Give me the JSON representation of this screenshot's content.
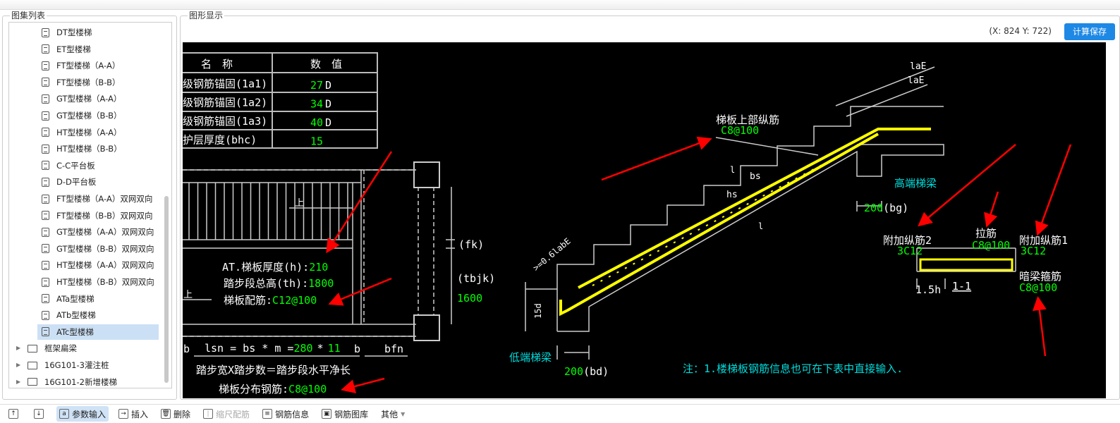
{
  "left_panel": {
    "title": "图集列表",
    "items": [
      {
        "label": "DT型楼梯",
        "type": "file"
      },
      {
        "label": "ET型楼梯",
        "type": "file"
      },
      {
        "label": "FT型楼梯（A-A）",
        "type": "file"
      },
      {
        "label": "FT型楼梯（B-B）",
        "type": "file"
      },
      {
        "label": "GT型楼梯（A-A）",
        "type": "file"
      },
      {
        "label": "GT型楼梯（B-B）",
        "type": "file"
      },
      {
        "label": "HT型楼梯（A-A）",
        "type": "file"
      },
      {
        "label": "HT型楼梯（B-B）",
        "type": "file"
      },
      {
        "label": "C-C平台板",
        "type": "file"
      },
      {
        "label": "D-D平台板",
        "type": "file"
      },
      {
        "label": "FT型楼梯（A-A）双网双向",
        "type": "file"
      },
      {
        "label": "FT型楼梯（B-B）双网双向",
        "type": "file"
      },
      {
        "label": "GT型楼梯（A-A）双网双向",
        "type": "file"
      },
      {
        "label": "GT型楼梯（B-B）双网双向",
        "type": "file"
      },
      {
        "label": "HT型楼梯（A-A）双网双向",
        "type": "file"
      },
      {
        "label": "HT型楼梯（B-B）双网双向",
        "type": "file"
      },
      {
        "label": "ATa型楼梯",
        "type": "file"
      },
      {
        "label": "ATb型楼梯",
        "type": "file"
      },
      {
        "label": "ATc型楼梯",
        "type": "file",
        "selected": true
      },
      {
        "label": "框架扁梁",
        "type": "folder"
      },
      {
        "label": "16G101-3灌注桩",
        "type": "folder"
      },
      {
        "label": "16G101-2新增楼梯",
        "type": "folder"
      }
    ]
  },
  "right_panel": {
    "title": "图形显示",
    "coords": "(X: 824 Y: 722)",
    "calc_save": "计算保存"
  },
  "drawing": {
    "table": {
      "headers": [
        "名　称",
        "数　值"
      ],
      "rows": [
        {
          "name": "级钢筋锚固(1a1)",
          "value": "27",
          "unit": "D"
        },
        {
          "name": "级钢筋锚固(1a2)",
          "value": "34",
          "unit": "D"
        },
        {
          "name": "级钢筋锚固(1a3)",
          "value": "40",
          "unit": "D"
        },
        {
          "name": "护层厚度(bhc)",
          "value": "15",
          "unit": ""
        }
      ]
    },
    "plan": {
      "up1": "上",
      "up2": "上",
      "thick_label": "AT.梯板厚度(h):",
      "thick": "210",
      "height_label": "踏步段总高(th):",
      "height": "1800",
      "rebar_label": "梯板配筋:",
      "rebar": "C12@100",
      "fk": "(fk)",
      "tbjk": "(tbjk)",
      "tbjk_val": "1600",
      "lsn_label": "lsn = bs * m =",
      "bs": "280",
      "mul": "*",
      "m": "11",
      "b1": "b",
      "b2": "b",
      "bfn": "bfn",
      "formula": "踏步宽X踏步数＝踏步段水平净长",
      "dist_label": "梯板分布钢筋:",
      "dist": "C8@100"
    },
    "section": {
      "top_rebar_label": "梯板上部纵筋",
      "top_rebar": "C8@100",
      "laE1": "laE",
      "laE2": "laE",
      "bs": "bs",
      "hs": "hs",
      "l1": "l",
      "l2": "l",
      "high_beam": "高端梯梁",
      "bg_val": "200",
      "bg": "(bg)",
      "labE": ">=0.6labE",
      "d15": "15d",
      "low_beam": "低端梯梁",
      "bd_val": "200",
      "bd": "(bd)",
      "note": "注：1.楼梯板钢筋信息也可在下表中直接输入."
    },
    "beam_section": {
      "add2": "附加纵筋2",
      "add2_val": "3C12",
      "tie": "拉筋",
      "tie_val": "C8@100",
      "add1": "附加纵筋1",
      "add1_val": "3C12",
      "stirrup": "暗梁箍筋",
      "stirrup_val": "C8@100",
      "w": "1.5h",
      "title": "1-1"
    }
  },
  "toolbar": {
    "items": [
      {
        "label": "",
        "icon": "move-up-icon"
      },
      {
        "label": "",
        "icon": "move-down-icon"
      },
      {
        "label": "参数输入",
        "icon": "param-icon",
        "active": true
      },
      {
        "label": "插入",
        "icon": "insert-icon"
      },
      {
        "label": "删除",
        "icon": "delete-icon"
      },
      {
        "label": "缩尺配筋",
        "icon": "scale-icon",
        "disabled": true
      },
      {
        "label": "钢筋信息",
        "icon": "info-icon"
      },
      {
        "label": "钢筋图库",
        "icon": "library-icon"
      },
      {
        "label": "其他",
        "icon": "dropdown-icon"
      }
    ]
  },
  "colors": {
    "green": "#00ff00",
    "yellow": "#ffff00",
    "cyan": "#00d8d8",
    "red": "#ff0000",
    "accent": "#1e88e5"
  }
}
